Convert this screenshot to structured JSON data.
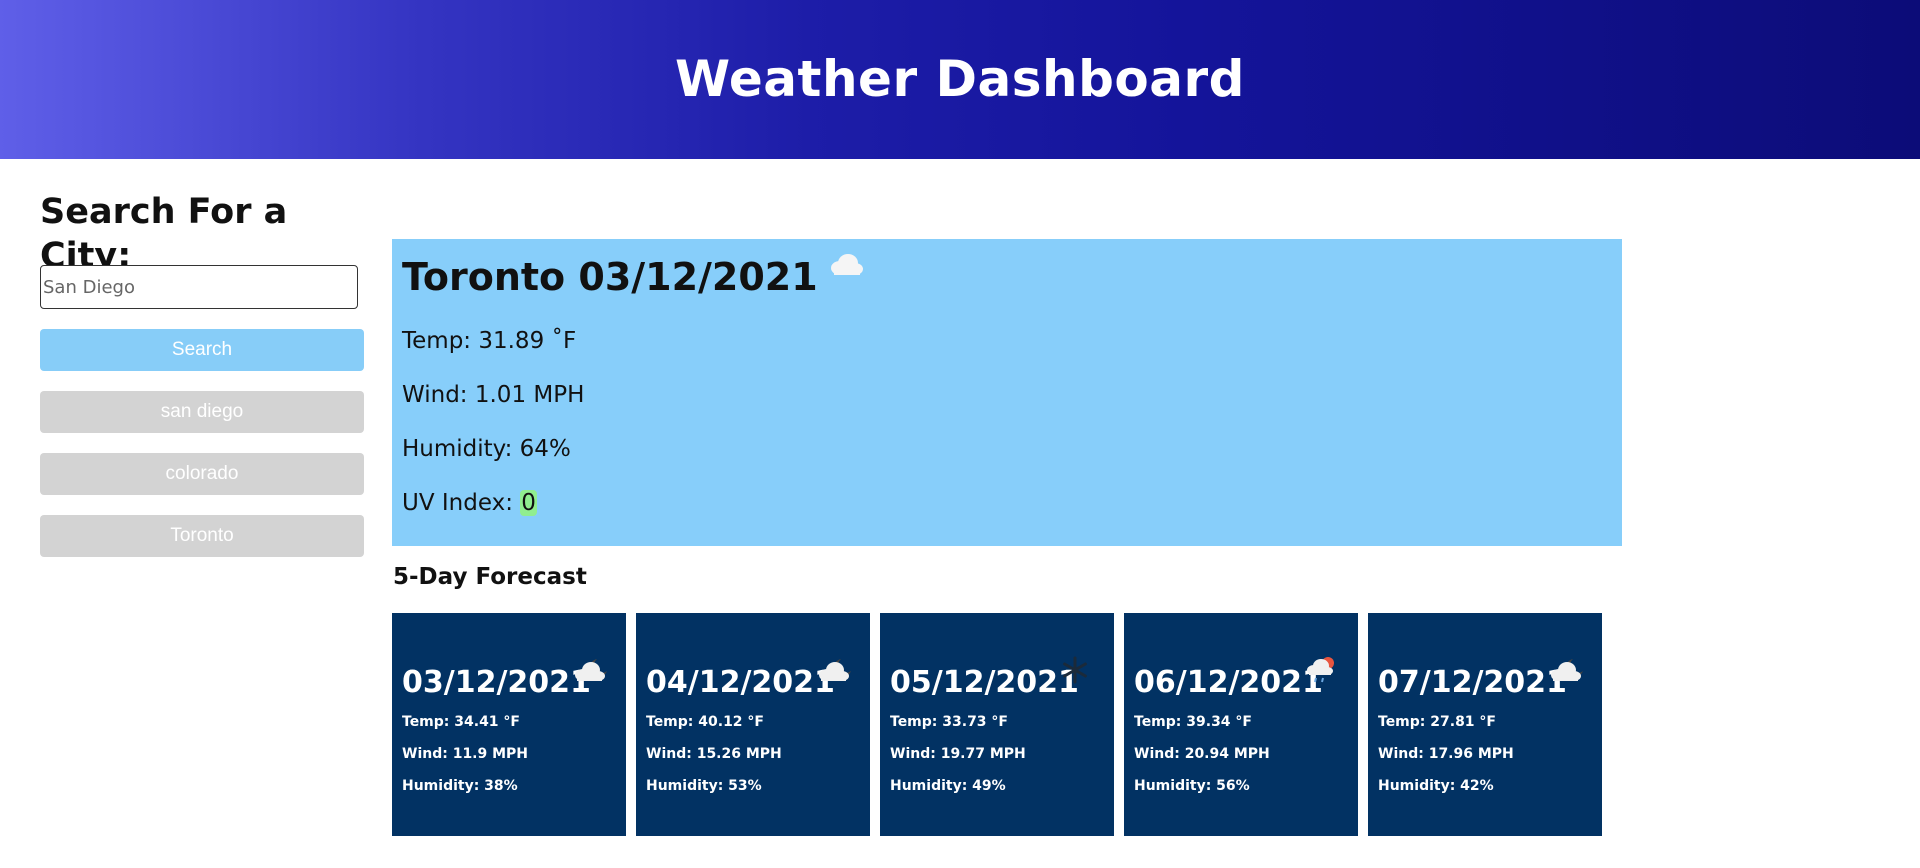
{
  "header": {
    "title": "Weather Dashboard"
  },
  "sidebar": {
    "heading": "Search For a City:",
    "search_placeholder": "San Diego",
    "search_button": "Search",
    "history": [
      "san diego",
      "colorado",
      "Toronto"
    ]
  },
  "current": {
    "city_date": "Toronto 03/12/2021",
    "icon": "cloud-icon",
    "temp": "Temp: 31.89 ˚F",
    "wind": "Wind: 1.01 MPH",
    "humidity": "Humidity: 64%",
    "uv_label": "UV Index: ",
    "uv_value": "0",
    "uv_color": "#90ee90"
  },
  "forecast": {
    "title": "5-Day Forecast",
    "days": [
      {
        "date": "03/12/2021",
        "icon": "cloud-night-icon",
        "temp": "Temp: 34.41 °F",
        "wind": "Wind: 11.9 MPH",
        "humidity": "Humidity: 38%"
      },
      {
        "date": "04/12/2021",
        "icon": "cloud-night-icon",
        "temp": "Temp: 40.12 °F",
        "wind": "Wind: 15.26 MPH",
        "humidity": "Humidity: 53%"
      },
      {
        "date": "05/12/2021",
        "icon": "snow-icon",
        "temp": "Temp: 33.73 °F",
        "wind": "Wind: 19.77 MPH",
        "humidity": "Humidity: 49%"
      },
      {
        "date": "06/12/2021",
        "icon": "rain-icon",
        "temp": "Temp: 39.34 °F",
        "wind": "Wind: 20.94 MPH",
        "humidity": "Humidity: 56%"
      },
      {
        "date": "07/12/2021",
        "icon": "cloud-night-icon",
        "temp": "Temp: 27.81 °F",
        "wind": "Wind: 17.96 MPH",
        "humidity": "Humidity: 42%"
      }
    ]
  },
  "colors": {
    "header_gradient_start": "#5f5fe8",
    "header_gradient_end": "#0c0c78",
    "current_bg": "#87cefa",
    "search_button_bg": "#87cdf8",
    "history_button_bg": "#d3d3d3",
    "card_bg": "#023263"
  }
}
